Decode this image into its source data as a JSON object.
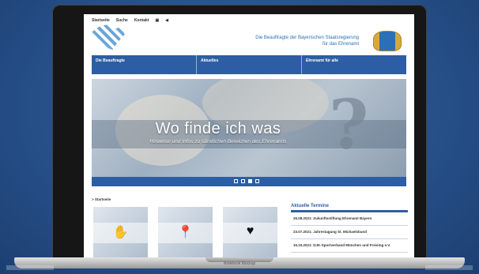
{
  "utility_nav": [
    "Startseite",
    "Suche",
    "Kontakt"
  ],
  "header": {
    "title_line1": "Die Beauftragte der Bayerischen Staatsregierung",
    "title_line2": "für das Ehrenamt"
  },
  "nav": [
    "Die Beauftragte",
    "Aktuelles",
    "Ehrenamt für alle"
  ],
  "hero": {
    "title": "Wo finde ich was",
    "subtitle": "Hinweise und Infos zu sämtlichen Bereichen des Ehrenamts",
    "symbol": "?"
  },
  "breadcrumb": "> Startseite",
  "tiles": [
    {
      "icon": "hands-icon",
      "glyph": "✋"
    },
    {
      "icon": "location-pin-icon",
      "glyph": "📍"
    },
    {
      "icon": "heart-hands-icon",
      "glyph": "♥"
    }
  ],
  "termine": {
    "heading": "Aktuelle Termine",
    "items": [
      "26.08.2021: Zukunftsstiftung Ehrenamt Bayern",
      "23.07.2021: Jahrestagung St. Michaelsbund",
      "16.10.2021: DJK-Sportverband München und Freising e.V."
    ]
  },
  "mockup_label": "Notebook Mockup",
  "colors": {
    "brand_blue": "#2d5ea5",
    "header_blue": "#2c6fb8"
  }
}
